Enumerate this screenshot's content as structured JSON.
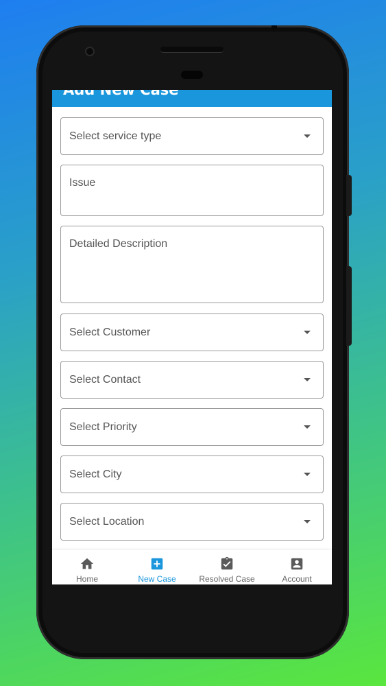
{
  "appbar": {
    "title": "Add New Case"
  },
  "form": {
    "service_type": {
      "placeholder": "Select service type"
    },
    "issue": {
      "placeholder": "Issue"
    },
    "description": {
      "placeholder": "Detailed Description"
    },
    "customer": {
      "placeholder": "Select Customer"
    },
    "contact": {
      "placeholder": "Select Contact"
    },
    "priority": {
      "placeholder": "Select Priority"
    },
    "city": {
      "placeholder": "Select City"
    },
    "location": {
      "placeholder": "Select Location"
    }
  },
  "bottom_nav": {
    "items": [
      {
        "label": "Home",
        "icon": "home-icon"
      },
      {
        "label": "New Case",
        "icon": "add-box-icon"
      },
      {
        "label": "Resolved Case",
        "icon": "clipboard-check-icon"
      },
      {
        "label": "Account",
        "icon": "account-box-icon"
      }
    ],
    "active_index": 1
  },
  "colors": {
    "primary": "#1a96dc",
    "inactive": "#666666",
    "border": "#9a9a9a"
  }
}
